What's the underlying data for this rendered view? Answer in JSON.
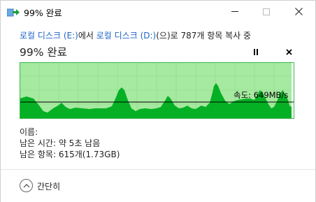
{
  "window": {
    "title": "99% 완료"
  },
  "description": {
    "source_link": "로컬 디스크 (E:)",
    "source_suffix": "에서 ",
    "dest_link": "로컬 디스크 (D:)",
    "dest_suffix": "(으)로 787개 항목 복사 중"
  },
  "progress": {
    "title": "99% 완료",
    "percent": 99,
    "speed_label": "속도: 649MB/s"
  },
  "details": {
    "name": "이름:",
    "time_remaining": "남은 시간: 약 5초 남음",
    "items_remaining": "남은 항목: 615개(1.73GB)"
  },
  "footer": {
    "collapse_label": "간단히"
  },
  "colors": {
    "graph_bg": "#a6e9a0",
    "graph_fill": "#06b025",
    "graph_border": "#39b54a",
    "link": "#1e64c8"
  }
}
